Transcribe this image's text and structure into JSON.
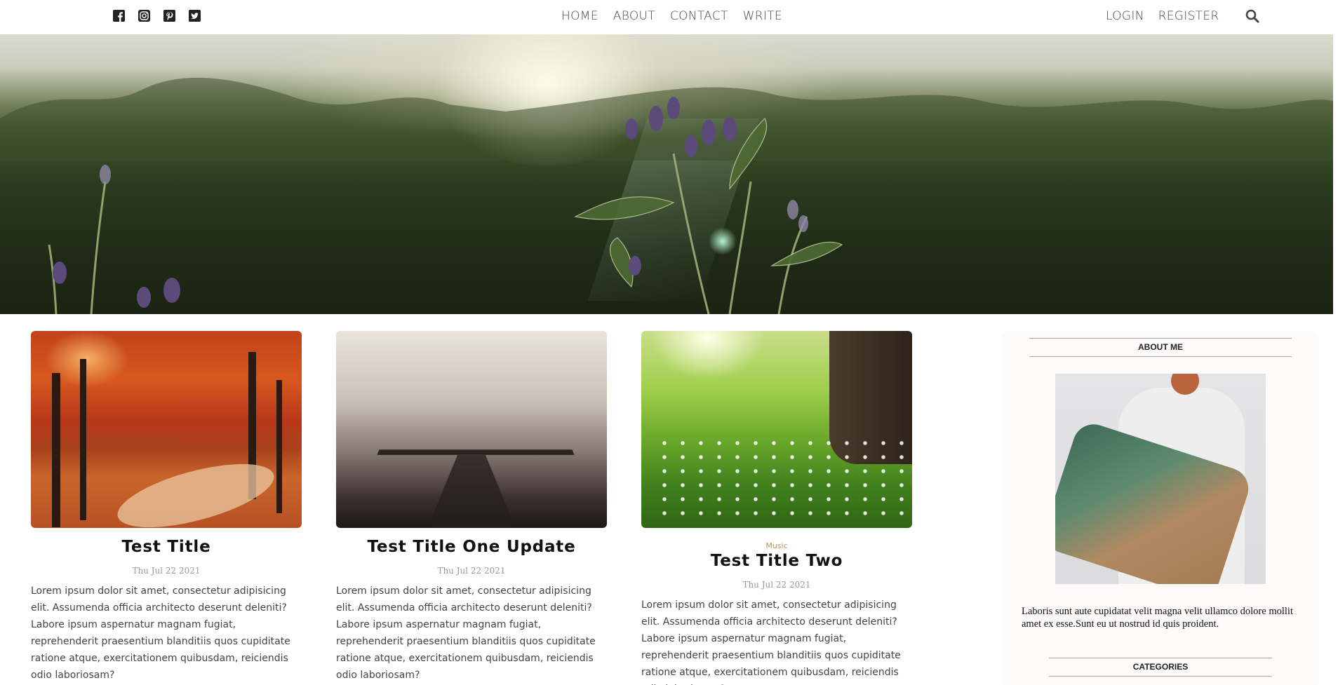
{
  "social": [
    {
      "name": "facebook-icon",
      "glyph": "f"
    },
    {
      "name": "instagram-icon",
      "glyph": "ig"
    },
    {
      "name": "pinterest-icon",
      "glyph": "p"
    },
    {
      "name": "twitter-icon",
      "glyph": "t"
    }
  ],
  "nav": {
    "home": "HOME",
    "about": "ABOUT",
    "contact": "CONTACT",
    "write": "WRITE",
    "login": "LOGIN",
    "register": "REGISTER",
    "search_icon": "search-icon"
  },
  "posts": [
    {
      "category": "",
      "title": "Test Title",
      "date": "Thu Jul 22 2021",
      "excerpt": "Lorem ipsum dolor sit amet, consectetur adipisicing elit. Assumenda officia architecto deserunt deleniti? Labore ipsum aspernatur magnam fugiat, reprehenderit praesentium blanditiis quos cupiditate ratione atque, exercitationem quibusdam, reiciendis odio laboriosam?"
    },
    {
      "category": "",
      "title": "Test Title One Update",
      "date": "Thu Jul 22 2021",
      "excerpt": "Lorem ipsum dolor sit amet, consectetur adipisicing elit. Assumenda officia architecto deserunt deleniti? Labore ipsum aspernatur magnam fugiat, reprehenderit praesentium blanditiis quos cupiditate ratione atque, exercitationem quibusdam, reiciendis odio laboriosam?"
    },
    {
      "category": "Music",
      "title": "Test Title Two",
      "date": "Thu Jul 22 2021",
      "excerpt": "Lorem ipsum dolor sit amet, consectetur adipisicing elit. Assumenda officia architecto deserunt deleniti? Labore ipsum aspernatur magnam fugiat, reprehenderit praesentium blanditiis quos cupiditate ratione atque, exercitationem quibusdam, reiciendis odio laboriosam?"
    }
  ],
  "sidebar": {
    "about_heading": "ABOUT ME",
    "about_text": "Laboris sunt aute cupidatat velit magna velit ullamco dolore mollit amet ex esse.Sunt eu ut nostrud id quis proident.",
    "categories_heading": "CATEGORIES"
  },
  "colors": {
    "accent": "#b5945a",
    "text": "#444444",
    "sidebar_bg": "#fdfafa"
  }
}
